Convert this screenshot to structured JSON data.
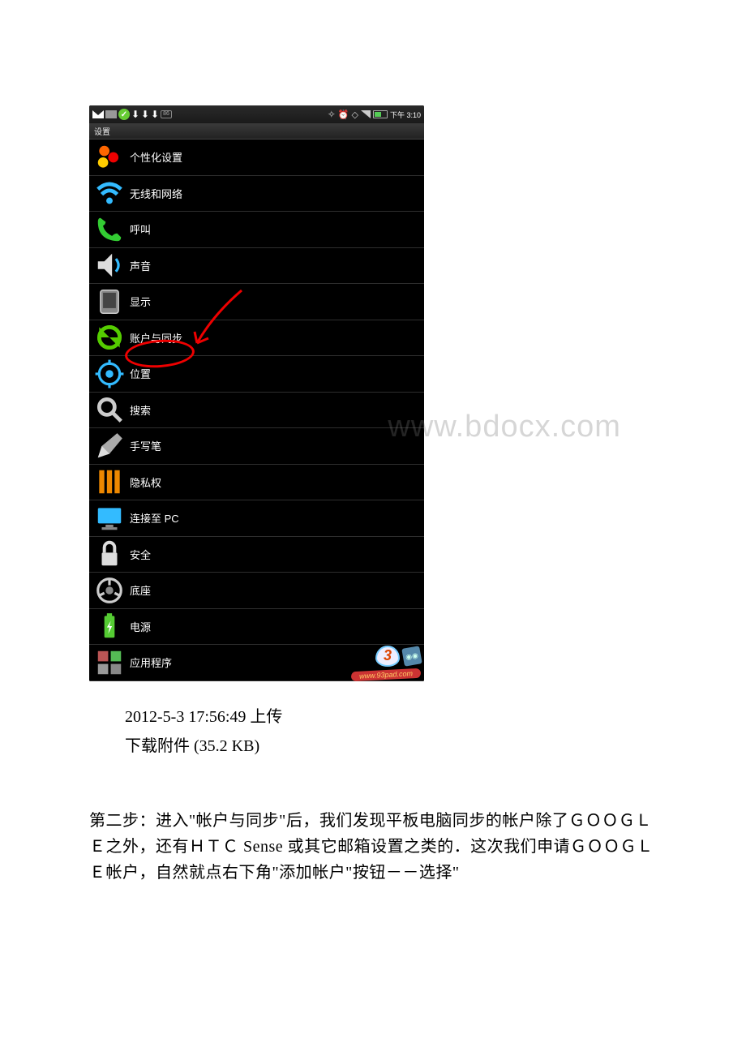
{
  "status_bar": {
    "time": "下午 3:10"
  },
  "screen_header": "设置",
  "settings": [
    {
      "key": "personalize",
      "label": "个性化设置"
    },
    {
      "key": "wireless",
      "label": "无线和网络"
    },
    {
      "key": "call",
      "label": "呼叫"
    },
    {
      "key": "sound",
      "label": "声音"
    },
    {
      "key": "display",
      "label": "显示"
    },
    {
      "key": "sync",
      "label": "账户与同步"
    },
    {
      "key": "location",
      "label": "位置"
    },
    {
      "key": "search",
      "label": "搜索"
    },
    {
      "key": "pen",
      "label": "手写笔"
    },
    {
      "key": "privacy",
      "label": "隐私权"
    },
    {
      "key": "pc",
      "label": "连接至 PC"
    },
    {
      "key": "security",
      "label": "安全"
    },
    {
      "key": "dock",
      "label": "底座"
    },
    {
      "key": "power",
      "label": "电源"
    },
    {
      "key": "apps",
      "label": "应用程序"
    }
  ],
  "watermark": "www.bdocx.com",
  "badge": {
    "number": "3",
    "url": "www.93pad.com",
    "face": "◉◉"
  },
  "caption": {
    "line1": "2012-5-3 17:56:49 上传",
    "line2": "下载附件 (35.2 KB)"
  },
  "body": "第二步：进入\"帐户与同步\"后，我们发现平板电脑同步的帐户除了ＧＯＯＧＬＥ之外，还有ＨＴＣ Sense 或其它邮箱设置之类的．这次我们申请ＧＯＯＧＬＥ帐户，自然就点右下角\"添加帐户\"按钮－－选择\""
}
